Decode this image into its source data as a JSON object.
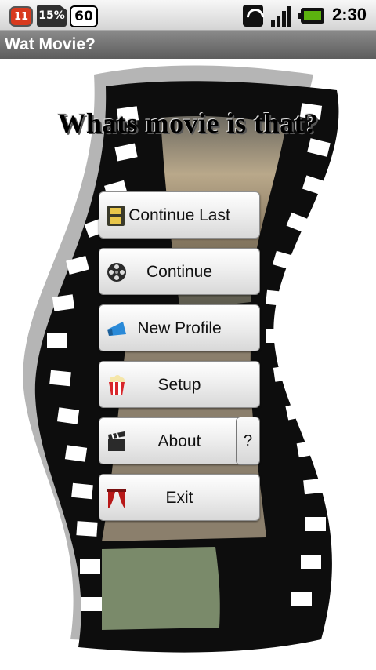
{
  "status_bar": {
    "notification_count": "11",
    "storage_label": "15%",
    "battery_percent": "60",
    "clock": "2:30",
    "icons": [
      "notification-badge-icon",
      "sd-card-icon",
      "wifi-icon",
      "signal-icon",
      "battery-icon"
    ]
  },
  "app": {
    "title": "Wat Movie?"
  },
  "main": {
    "headline": "Whats movie is that?",
    "buttons": [
      {
        "label": "Continue Last",
        "icon": "film-frames-icon"
      },
      {
        "label": "Continue",
        "icon": "film-reel-icon"
      },
      {
        "label": "New Profile",
        "icon": "megaphone-icon"
      },
      {
        "label": "Setup",
        "icon": "popcorn-icon"
      },
      {
        "label": "About",
        "icon": "clapperboard-icon"
      },
      {
        "label": "Exit",
        "icon": "theater-curtain-icon"
      }
    ],
    "help_label": "?"
  }
}
